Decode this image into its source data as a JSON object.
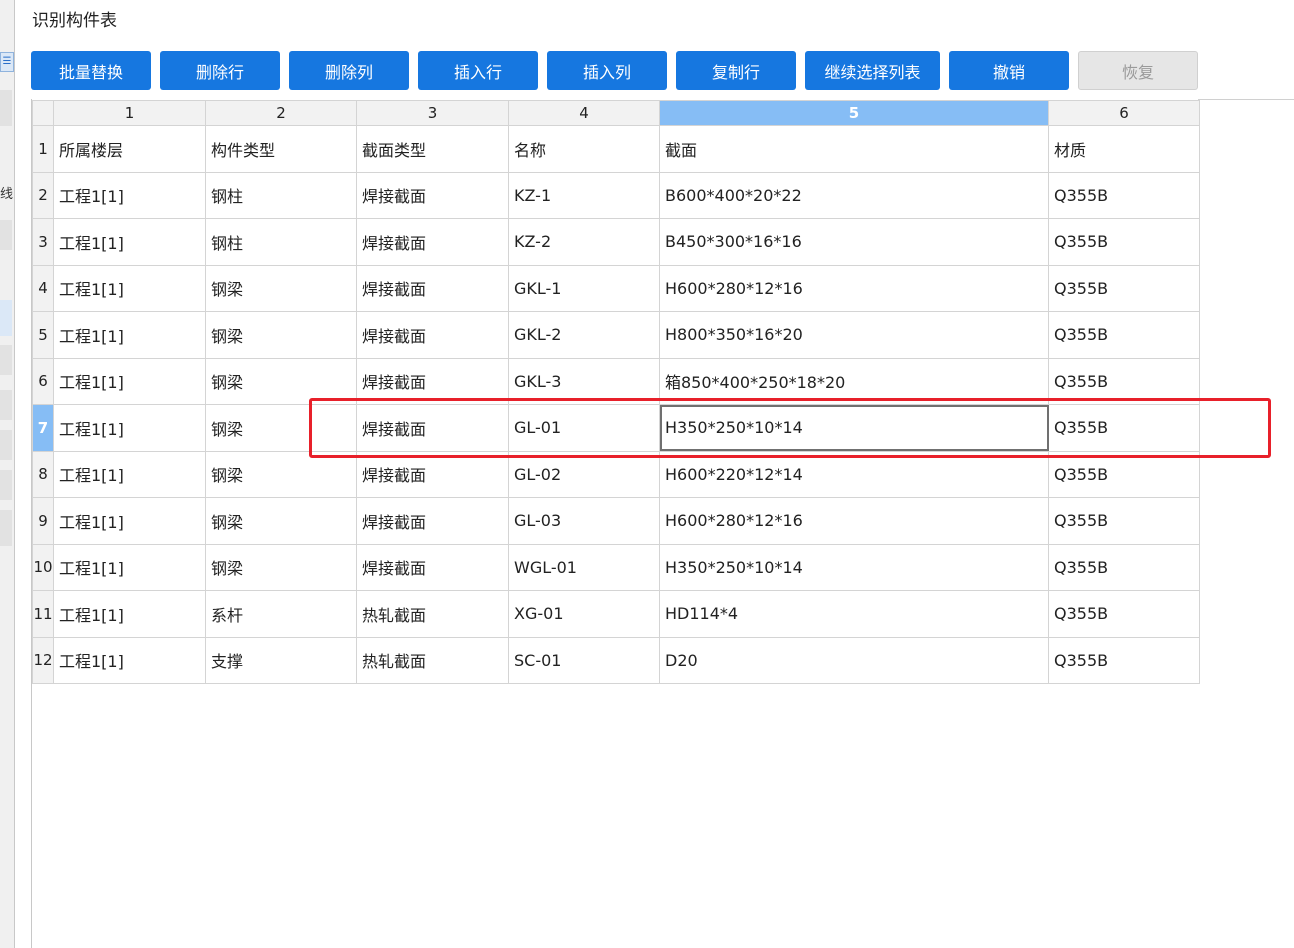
{
  "sidebar": {
    "partial_text": "线("
  },
  "dialog": {
    "title": "识别构件表"
  },
  "toolbar": {
    "batch_replace": "批量替换",
    "delete_row": "删除行",
    "delete_col": "删除列",
    "insert_row": "插入行",
    "insert_col": "插入列",
    "copy_row": "复制行",
    "continue_select": "继续选择列表",
    "undo": "撤销",
    "redo": "恢复"
  },
  "grid": {
    "column_headers": [
      "1",
      "2",
      "3",
      "4",
      "5",
      "6"
    ],
    "active_column": "5",
    "active_row": "7",
    "rows": [
      {
        "num": "1",
        "cells": [
          "所属楼层",
          "构件类型",
          "截面类型",
          "名称",
          "截面",
          "材质"
        ]
      },
      {
        "num": "2",
        "cells": [
          "工程1[1]",
          "钢柱",
          "焊接截面",
          "KZ-1",
          "B600*400*20*22",
          "Q355B"
        ]
      },
      {
        "num": "3",
        "cells": [
          "工程1[1]",
          "钢柱",
          "焊接截面",
          "KZ-2",
          "B450*300*16*16",
          "Q355B"
        ]
      },
      {
        "num": "4",
        "cells": [
          "工程1[1]",
          "钢梁",
          "焊接截面",
          "GKL-1",
          "H600*280*12*16",
          "Q355B"
        ]
      },
      {
        "num": "5",
        "cells": [
          "工程1[1]",
          "钢梁",
          "焊接截面",
          "GKL-2",
          "H800*350*16*20",
          "Q355B"
        ]
      },
      {
        "num": "6",
        "cells": [
          "工程1[1]",
          "钢梁",
          "焊接截面",
          "GKL-3",
          "箱850*400*250*18*20",
          "Q355B"
        ]
      },
      {
        "num": "7",
        "cells": [
          "工程1[1]",
          "钢梁",
          "焊接截面",
          "GL-01",
          "H350*250*10*14",
          "Q355B"
        ]
      },
      {
        "num": "8",
        "cells": [
          "工程1[1]",
          "钢梁",
          "焊接截面",
          "GL-02",
          "H600*220*12*14",
          "Q355B"
        ]
      },
      {
        "num": "9",
        "cells": [
          "工程1[1]",
          "钢梁",
          "焊接截面",
          "GL-03",
          "H600*280*12*16",
          "Q355B"
        ]
      },
      {
        "num": "10",
        "cells": [
          "工程1[1]",
          "钢梁",
          "焊接截面",
          "WGL-01",
          "H350*250*10*14",
          "Q355B"
        ]
      },
      {
        "num": "11",
        "cells": [
          "工程1[1]",
          "系杆",
          "热轧截面",
          "XG-01",
          "HD114*4",
          "Q355B"
        ]
      },
      {
        "num": "12",
        "cells": [
          "工程1[1]",
          "支撑",
          "热轧截面",
          "SC-01",
          "D20",
          "Q355B"
        ]
      }
    ]
  },
  "colors": {
    "button_blue": "#1677e0",
    "header_active": "#86bdf5",
    "highlight_red": "#e8202a"
  }
}
